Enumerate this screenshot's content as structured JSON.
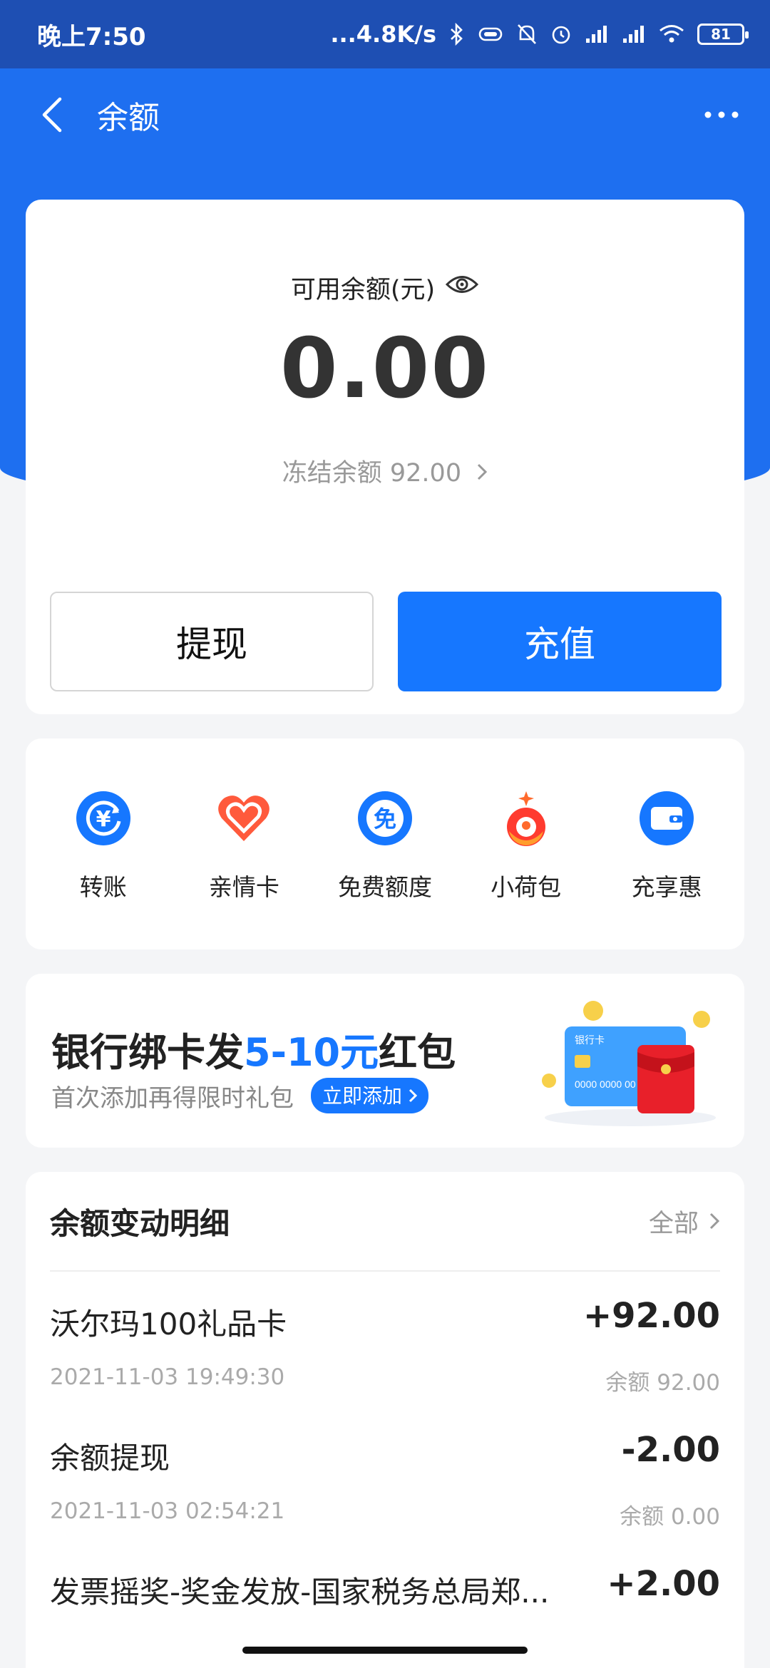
{
  "status_bar": {
    "time": "晚上7:50",
    "net_speed": "...4.8K/s",
    "battery": "81"
  },
  "nav": {
    "title": "余额"
  },
  "balance": {
    "label": "可用余额(元)",
    "amount": "0.00",
    "frozen": "冻结余额 92.00",
    "withdraw_label": "提现",
    "recharge_label": "充值"
  },
  "services": [
    {
      "label": "转账",
      "icon": "transfer-icon",
      "color": "#1677ff"
    },
    {
      "label": "亲情卡",
      "icon": "heart-icon",
      "color": "#ff5a3c"
    },
    {
      "label": "免费额度",
      "icon": "free-icon",
      "color": "#1677ff"
    },
    {
      "label": "小荷包",
      "icon": "pouch-icon",
      "color": "#ff6a2c"
    },
    {
      "label": "充享惠",
      "icon": "wallet-icon",
      "color": "#1677ff"
    }
  ],
  "promo": {
    "title_prefix": "银行绑卡发",
    "title_highlight": "5-10元",
    "title_suffix": "红包",
    "subtitle": "首次添加再得限时礼包",
    "link": "立即添加",
    "card_label": "银行卡",
    "card_number": "0000  0000  00"
  },
  "details": {
    "title": "余额变动明细",
    "all_label": "全部",
    "rows": [
      {
        "name": "沃尔玛100礼品卡",
        "amount": "+92.00",
        "time": "2021-11-03 19:49:30",
        "balance": "余额 92.00"
      },
      {
        "name": "余额提现",
        "amount": "-2.00",
        "time": "2021-11-03 02:54:21",
        "balance": "余额 0.00"
      },
      {
        "name": "发票摇奖-奖金发放-国家税务总局郑...",
        "amount": "+2.00",
        "time": "",
        "balance": ""
      }
    ]
  },
  "colors": {
    "accent": "#1677ff",
    "header": "#1e6ff0",
    "status_bar": "#1e4fb3"
  }
}
